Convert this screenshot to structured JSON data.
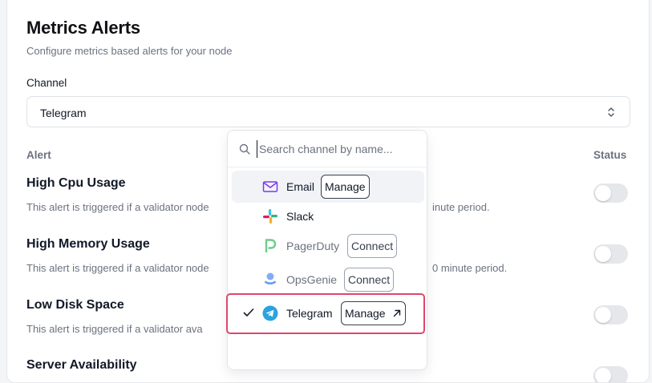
{
  "header": {
    "title": "Metrics Alerts",
    "subtitle": "Configure metrics based alerts for your node"
  },
  "channel": {
    "label": "Channel",
    "selected": "Telegram"
  },
  "table": {
    "col_alert": "Alert",
    "col_status": "Status"
  },
  "alerts": [
    {
      "title": "High Cpu Usage",
      "desc_left": "This alert is triggered if a validator node",
      "desc_right": "inute period.",
      "enabled": false
    },
    {
      "title": "High Memory Usage",
      "desc_left": "This alert is triggered if a validator node",
      "desc_right": "0 minute period.",
      "enabled": false
    },
    {
      "title": "Low Disk Space",
      "desc_left": "This alert is triggered if a validator ava",
      "desc_right": "",
      "enabled": false
    },
    {
      "title": "Server Availability",
      "desc_left": "",
      "desc_right": "",
      "enabled": false
    }
  ],
  "dropdown": {
    "search_placeholder": "Search channel by name...",
    "options": [
      {
        "label": "Email",
        "action": "Manage",
        "icon": "email-icon",
        "selected": false
      },
      {
        "label": "Slack",
        "action": "",
        "icon": "slack-icon",
        "selected": false
      },
      {
        "label": "PagerDuty",
        "action": "Connect",
        "icon": "pagerduty-icon",
        "selected": false
      },
      {
        "label": "OpsGenie",
        "action": "Connect",
        "icon": "opsgenie-icon",
        "selected": false
      },
      {
        "label": "Telegram",
        "action": "Manage",
        "icon": "telegram-icon",
        "selected": true
      }
    ]
  },
  "colors": {
    "highlight": "#e0466b",
    "email": "#7c3aed",
    "telegram": "#2aa3df",
    "pagerduty": "#06ac38",
    "opsgenie": "#2563eb"
  }
}
